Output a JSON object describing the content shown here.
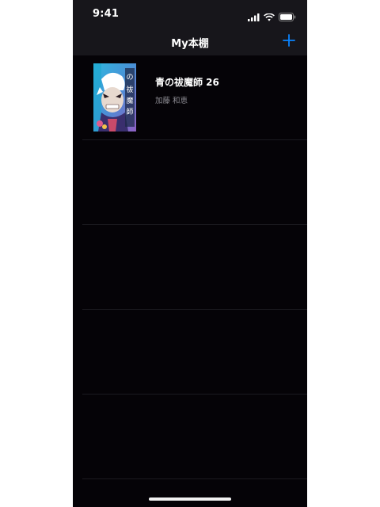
{
  "status_bar": {
    "time": "9:41",
    "icons": [
      "cellular-signal-icon",
      "wifi-icon",
      "battery-icon"
    ]
  },
  "nav": {
    "title": "My本棚",
    "add_icon": "plus-icon",
    "accent_color": "#0a84ff"
  },
  "books": [
    {
      "title": "青の祓魔師 26",
      "author": "加藤 和恵",
      "cover_icon": "book-cover-image"
    }
  ],
  "colors": {
    "background": "#050307",
    "bar": "#17161b",
    "separator": "#1b1a20",
    "secondary_text": "#8e8d94"
  }
}
